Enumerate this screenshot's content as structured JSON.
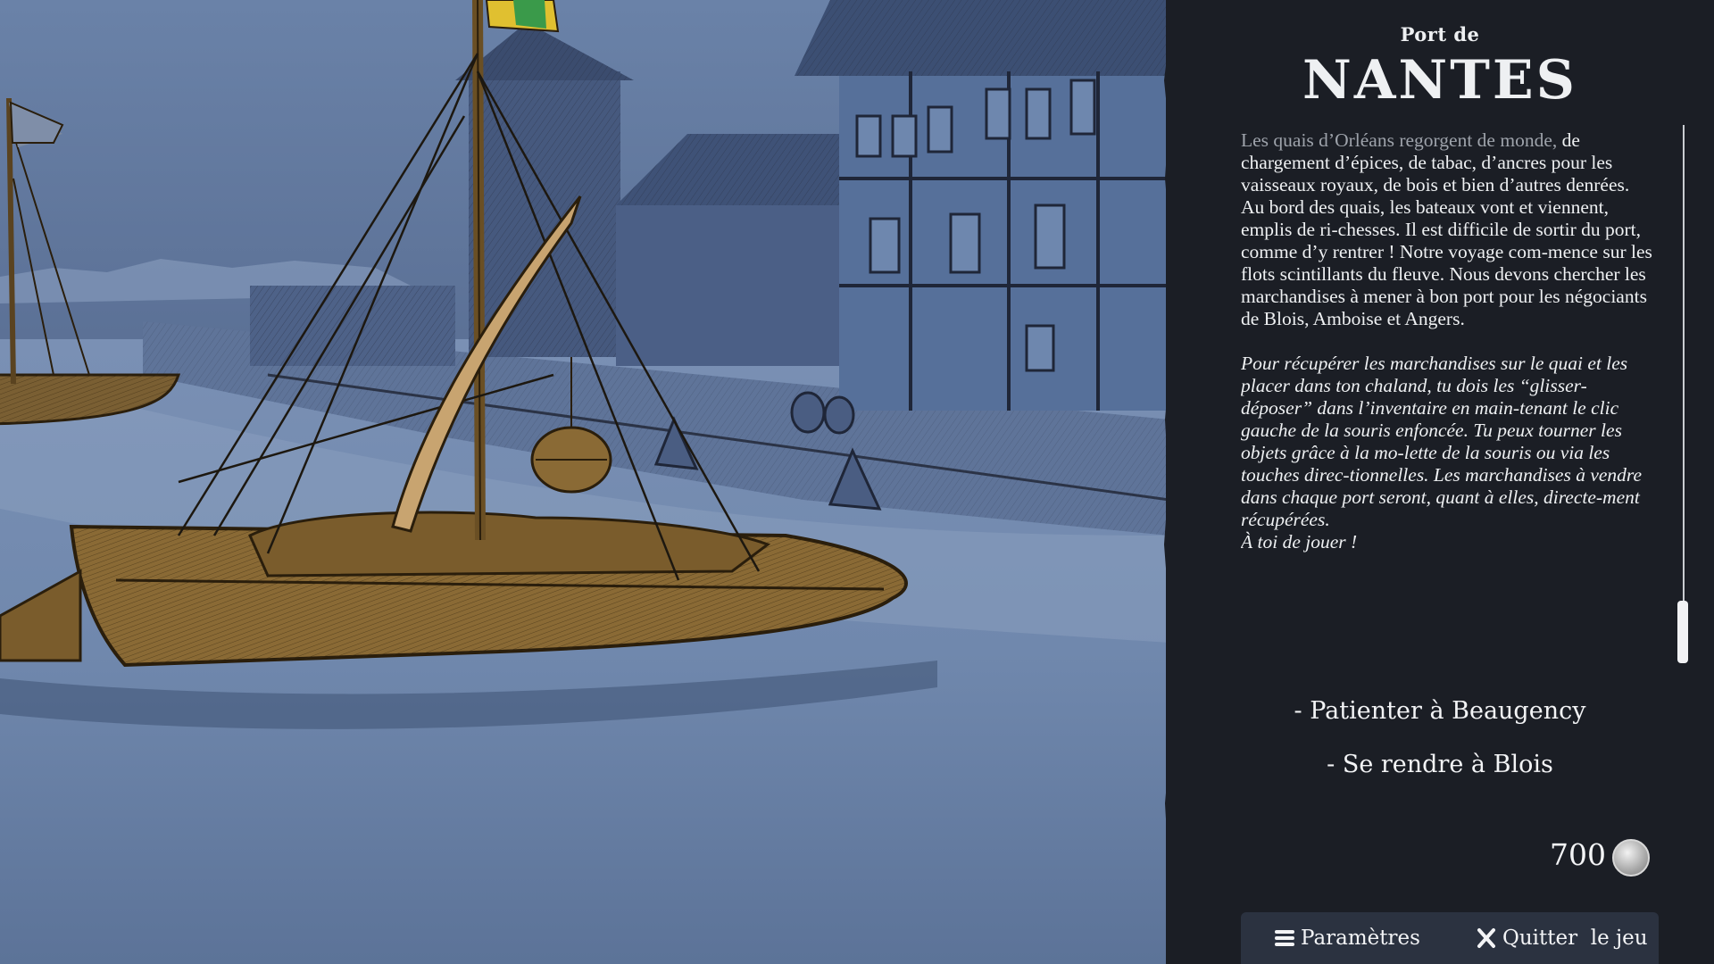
{
  "location": {
    "prefix": "Port de",
    "name": "NANTES"
  },
  "story": {
    "paragraph1_first": "Les quais d’Orléans regorgent de monde,",
    "paragraph1_rest": "de chargement d’épices, de tabac, d’ancres pour les vaisseaux royaux, de bois et bien d’autres denrées. Au bord des quais, les bateaux vont et viennent, emplis de ri-chesses. Il est difficile de sortir du port, comme d’y rentrer ! Notre voyage com-mence sur les flots scintillants du fleuve. Nous devons chercher les marchandises à mener à bon port pour les négociants de Blois, Amboise et Angers.",
    "paragraph2": "Pour récupérer les marchandises sur le quai et les placer dans ton chaland, tu dois les “glisser-déposer” dans l’inventaire en main-tenant le clic gauche de la souris enfoncée. Tu peux tourner les objets grâce à la mo-lette de la souris ou via les touches direc-tionnelles. Les marchandises à vendre dans chaque port seront, quant à elles, directe-ment récupérées.",
    "closing": "À toi de jouer !"
  },
  "scroll": {
    "position": 1.0
  },
  "choices": [
    {
      "label": "- Patienter à Beaugency"
    },
    {
      "label": "- Se rendre à Blois"
    }
  ],
  "money": {
    "amount": "700",
    "icon": "coin-icon"
  },
  "bottom_bar": {
    "settings_label": "Paramètres",
    "settings_icon": "menu-icon",
    "quit_label": "Quitter  le jeu",
    "quit_icon": "close-icon"
  },
  "colors": {
    "panel_bg": "#1b1e25",
    "scene_blue": "#5d7499",
    "boat_wood": "#8a6a35",
    "flag_green": "#3a9a4a",
    "flag_yellow": "#e0c030",
    "bottom_bar_bg": "#2b3240"
  }
}
